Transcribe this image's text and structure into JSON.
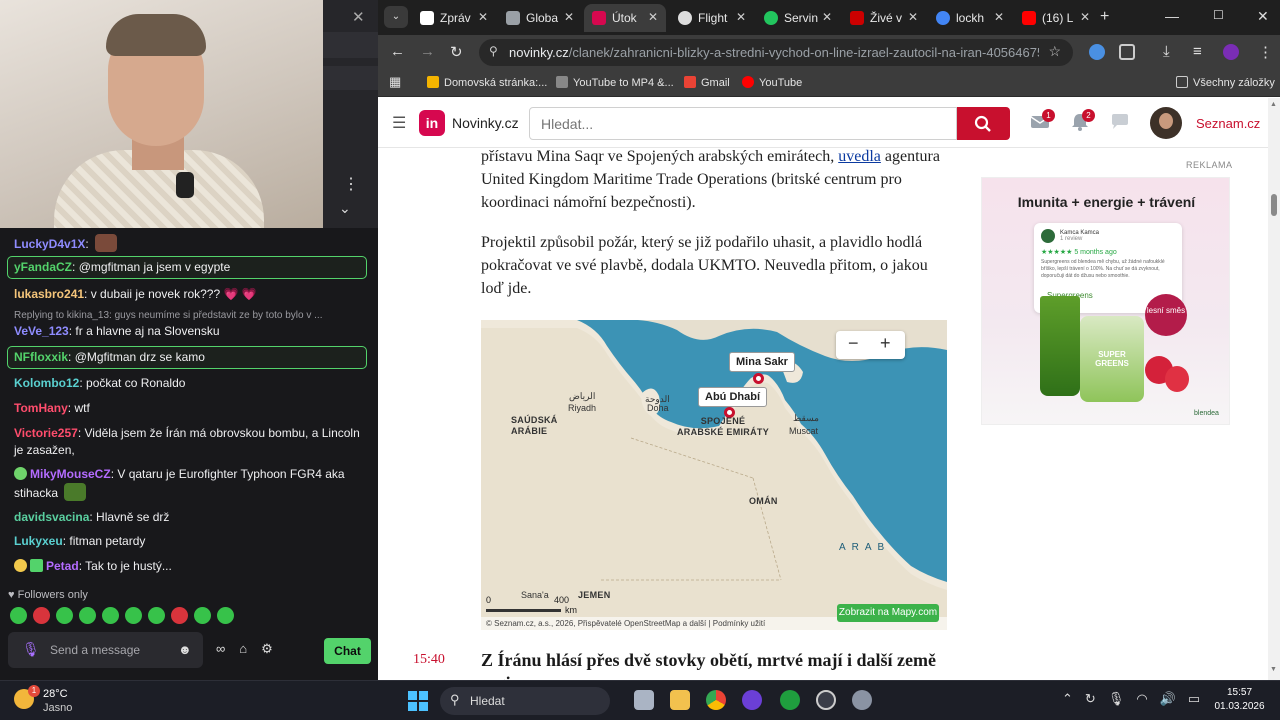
{
  "chat": {
    "messages": [
      {
        "user": "LuckyD4v1X",
        "text": "",
        "color": "#8f8cff",
        "highlight": false
      },
      {
        "user": "yFandaCZ",
        "text": "@mgfitman ja jsem v egypte",
        "color": "#53d36b",
        "highlight": true
      },
      {
        "user": "lukasbro241",
        "text": "v dubaii je novek rok??? 💗 💗",
        "color": "#f5c57a",
        "highlight": false
      },
      {
        "user": "VeVe_123",
        "text": "fr a hlavne aj na Slovensku",
        "color": "#8f8cff",
        "highlight": false
      },
      {
        "user": "NFfloxxik",
        "text": "@Mgfitman drz se kamo",
        "color": "#53d36b",
        "highlight": true
      },
      {
        "user": "Kolombo12",
        "text": "počkat co Ronaldo",
        "color": "#5ad0d0",
        "highlight": false
      },
      {
        "user": "TomHany",
        "text": "wtf",
        "color": "#ff4d6d",
        "highlight": false
      },
      {
        "user": "Victorie257",
        "text": "Viděla jsem že Írán má obrovskou bombu, a Lincoln je zasažen,",
        "color": "#ff4d6d",
        "highlight": false
      },
      {
        "user": "MikyMouseCZ",
        "text": "V qataru je Eurofighter Typhoon FGR4 aka stihacka",
        "color": "#b46cff",
        "highlight": false
      },
      {
        "user": "davidsvacina",
        "text": "Hlavně se drž",
        "color": "#5ad0a0",
        "highlight": false
      },
      {
        "user": "Lukyxeu",
        "text": "fitman petardy",
        "color": "#5ad0d0",
        "highlight": false
      },
      {
        "user": "Petad",
        "text": "Tak to je hustý...",
        "color": "#b46cff",
        "highlight": false
      }
    ],
    "reply_to": "Replying to kikina_13: guys neumíme si představit ze by toto bylo v ...",
    "followers_only": "Followers only",
    "send_placeholder": "Send a message",
    "chat_button": "Chat",
    "accent": "#53d36b"
  },
  "browser": {
    "tabs": [
      {
        "title": "Zpráv",
        "favicon_color": "#ffffff"
      },
      {
        "title": "Globa",
        "favicon_color": "#9aa0a6"
      },
      {
        "title": "Útok",
        "favicon_color": "#d6084f"
      },
      {
        "title": "Flight",
        "favicon_color": "#dddddd"
      },
      {
        "title": "Servin",
        "favicon_color": "#22c55e"
      },
      {
        "title": "Živé v",
        "favicon_color": "#cc0000"
      },
      {
        "title": "lockh",
        "favicon_color": "#4285f4"
      },
      {
        "title": "(16) L",
        "favicon_color": "#ff0000"
      }
    ],
    "url_host": "novinky.cz",
    "url_path": "/clanek/zahranicni-blizky-a-stredni-vychod-on-line-izrael-zautocil-na-iran-40564675#dop_...",
    "bookmarks": [
      {
        "label": "Domovská stránka:...",
        "color": "#f4b400"
      },
      {
        "label": "YouTube to MP4 &...",
        "color": "#888888"
      },
      {
        "label": "Gmail",
        "color": "#ea4335"
      },
      {
        "label": "YouTube",
        "color": "#ff0000"
      }
    ],
    "all_bookmarks": "Všechny záložky"
  },
  "site": {
    "logo_mark": "in",
    "logo_text": "Novinky.cz",
    "search_placeholder": "Hledat...",
    "mail_badge": "1",
    "bell_badge": "2",
    "seznam": "Seznam.cz",
    "brand_color": "#c8102e"
  },
  "article": {
    "p1_before": "přístavu Mina Saqr ve Spojených arabských emirátech, ",
    "p1_link": "uvedla",
    "p1_after": " agentura United Kingdom Maritime Trade Operations (britské centrum pro koordinaci námořní bezpečnosti).",
    "p2": "Projektil způsobil požár, který se již podařilo uhasit, a plavidlo hodlá pokračovat ve své plavbě, dodala UKMTO. Neuvedla přitom, o jakou loď jde.",
    "next_time": "15:40",
    "next_headline": "Z Íránu hlásí přes dvě stovky obětí, mrtvé mají i další země regionu"
  },
  "map": {
    "pin1": "Mina Sakr",
    "pin2": "Abú Dhabí",
    "labels": {
      "riyadh_ar": "الرياض",
      "riyadh": "Riyadh",
      "doha_ar": "الدوحة",
      "doha": "Doha",
      "saudi": "SAÚDSKÁ ARÁBIE",
      "uae": "SPOJENÉ ARABSKÉ EMIRÁTY",
      "muscat_ar": "مسقط",
      "muscat": "Muscat",
      "oman": "OMÁN",
      "yemen": "JEMEN",
      "sanaa": "Sana'a",
      "sea": "ARAB"
    },
    "scale_0": "0",
    "scale_400": "400",
    "scale_unit": "km",
    "credits": "© Seznam.cz, a.s., 2026, Přispěvatelé OpenStreetMap a další | Podmínky užití",
    "open_button": "Zobrazit na Mapy.com",
    "zoom_out": "−",
    "zoom_in": "+"
  },
  "ad": {
    "label": "REKLAMA",
    "title": "Imunita + energie + trávení",
    "reviewer": "Kamca Kamca",
    "reviewer_sub": "1 review",
    "stars": "★★★★★ 5 months ago",
    "review": "Supergreens od blendea mě chybu, už žádné nafoukklé bříško, lepší trávení o 100%. Na chuť se dá zvyknout, doporučuji dát do džusu nebo smoothie.",
    "product": "Supergreens",
    "jar_label": "SUPER GREENS",
    "badge": "lesní směs",
    "brand": "blendea"
  },
  "taskbar": {
    "temp": "28°C",
    "condition": "Jasno",
    "weather_badge": "1",
    "search_placeholder": "Hledat",
    "time": "15:57",
    "date": "01.03.2026"
  }
}
